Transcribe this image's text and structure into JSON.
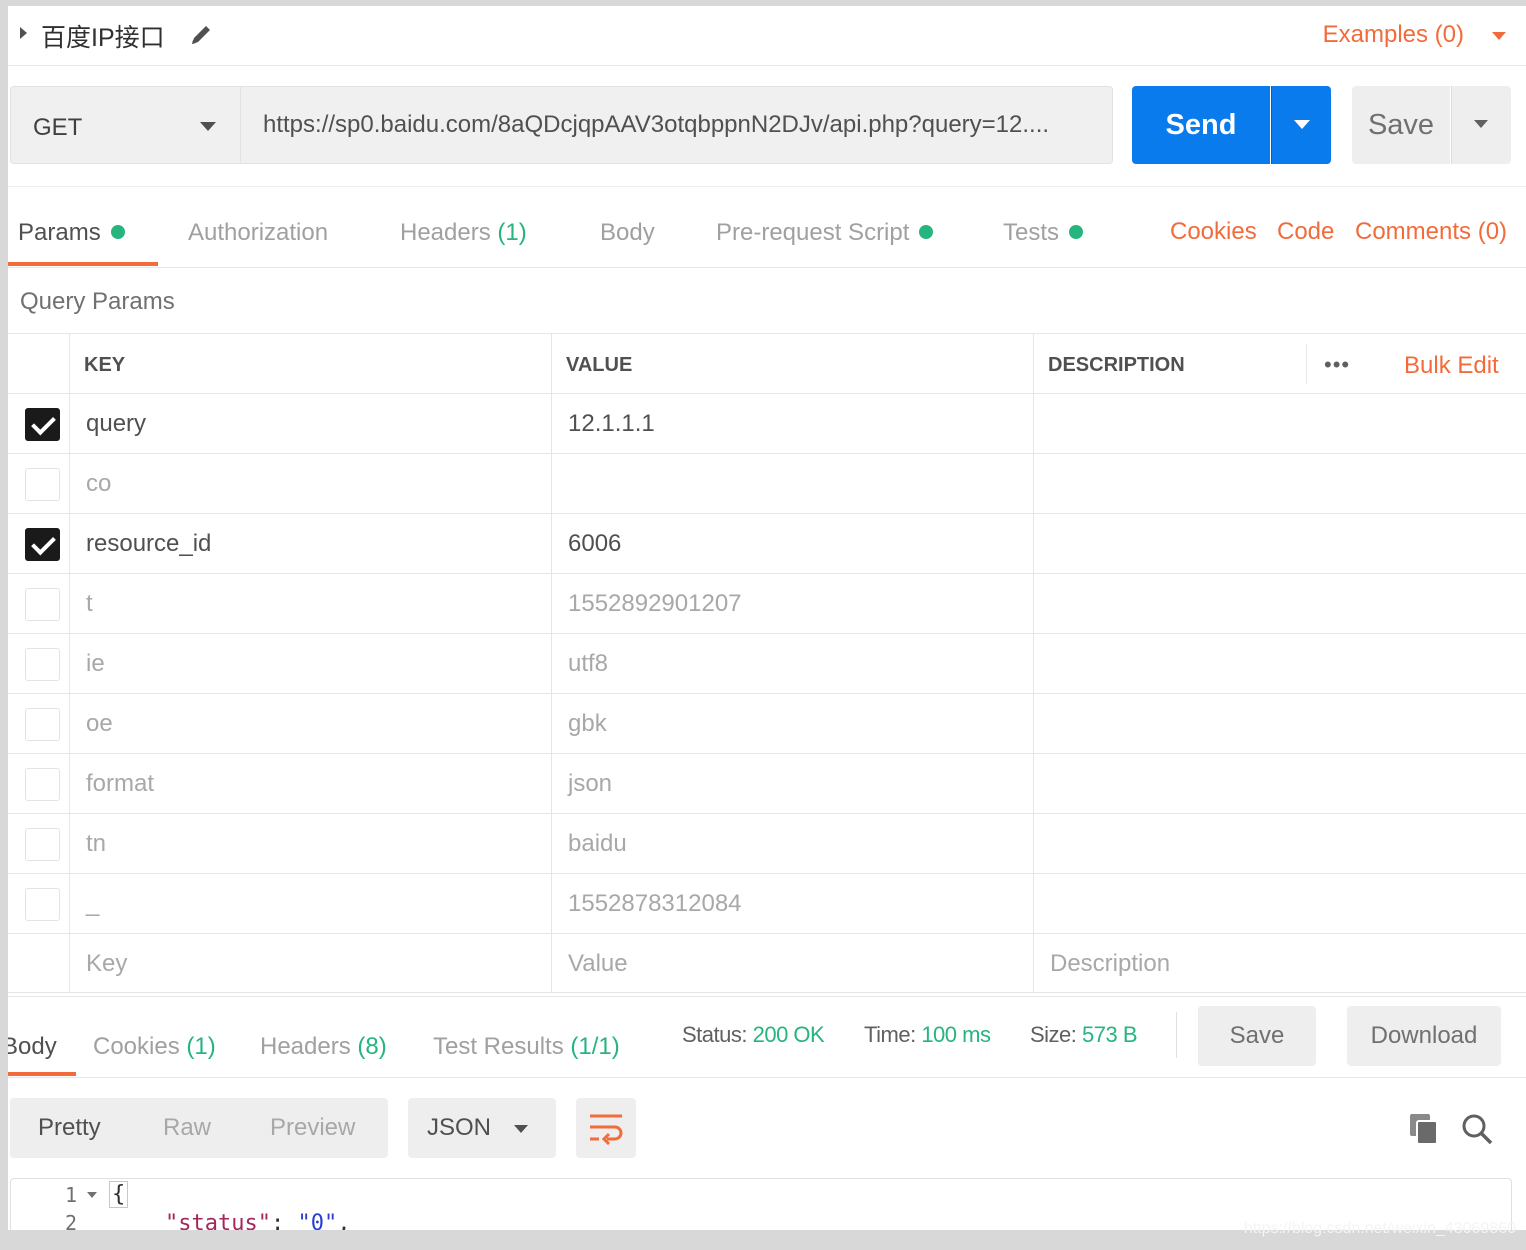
{
  "request": {
    "name": "百度IP接口",
    "examples_label": "Examples (0)",
    "method": "GET",
    "url": "https://sp0.baidu.com/8aQDcjqpAAV3otqbppnN2DJv/api.php?query=12....",
    "send_label": "Send",
    "save_label": "Save"
  },
  "request_tabs": {
    "params": "Params",
    "authorization": "Authorization",
    "headers": "Headers",
    "headers_count": "(1)",
    "body": "Body",
    "pre_request": "Pre-request Script",
    "tests": "Tests",
    "cookies": "Cookies",
    "code": "Code",
    "comments": "Comments (0)"
  },
  "params": {
    "title": "Query Params",
    "headers": {
      "key": "KEY",
      "value": "VALUE",
      "description": "DESCRIPTION",
      "bulk_edit": "Bulk Edit",
      "more": "•••"
    },
    "rows": [
      {
        "checked": true,
        "key": "query",
        "value": "12.1.1.1",
        "description": ""
      },
      {
        "checked": false,
        "key": "co",
        "value": "",
        "description": ""
      },
      {
        "checked": true,
        "key": "resource_id",
        "value": "6006",
        "description": ""
      },
      {
        "checked": false,
        "key": "t",
        "value": "1552892901207",
        "description": ""
      },
      {
        "checked": false,
        "key": "ie",
        "value": "utf8",
        "description": ""
      },
      {
        "checked": false,
        "key": "oe",
        "value": "gbk",
        "description": ""
      },
      {
        "checked": false,
        "key": "format",
        "value": "json",
        "description": ""
      },
      {
        "checked": false,
        "key": "tn",
        "value": "baidu",
        "description": ""
      },
      {
        "checked": false,
        "key": "_",
        "value": "1552878312084",
        "description": ""
      }
    ],
    "placeholders": {
      "key": "Key",
      "value": "Value",
      "description": "Description"
    }
  },
  "response": {
    "tabs": {
      "body": "Body",
      "cookies": "Cookies",
      "cookies_count": "(1)",
      "headers": "Headers",
      "headers_count": "(8)",
      "test_results": "Test Results",
      "test_results_count": "(1/1)"
    },
    "status_label": "Status:",
    "status_value": "200 OK",
    "time_label": "Time:",
    "time_value": "100 ms",
    "size_label": "Size:",
    "size_value": "573 B",
    "save_label": "Save",
    "download_label": "Download",
    "view_modes": [
      "Pretty",
      "Raw",
      "Preview"
    ],
    "format": "JSON",
    "code_lines": [
      {
        "num": "1",
        "text": "{"
      },
      {
        "num": "2",
        "key": "\"status\"",
        "value": "\"0\""
      }
    ]
  },
  "watermark": "https://blog.csdn.net/weixin_43069860",
  "colors": {
    "accent": "#f26b3a",
    "primary": "#097bed",
    "success": "#26b47f"
  }
}
